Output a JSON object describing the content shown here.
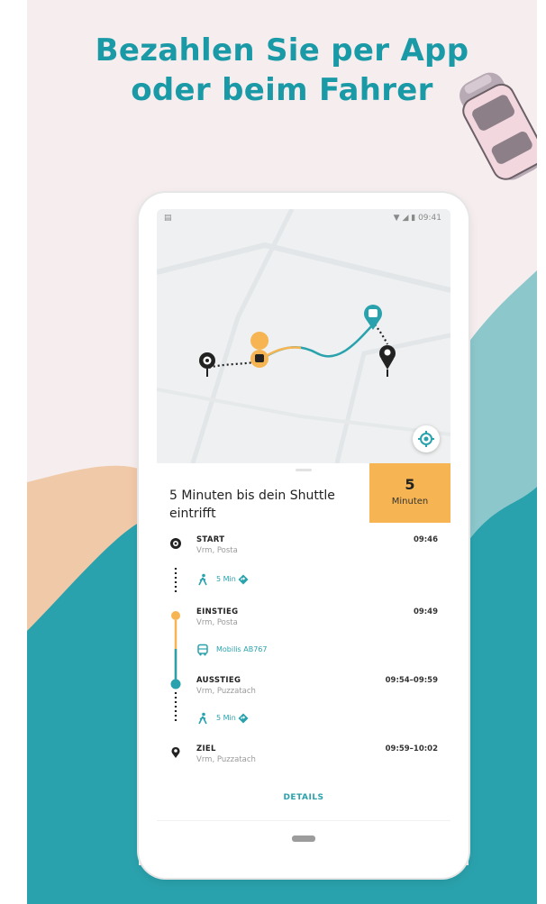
{
  "headline": {
    "line1": "Bezahlen Sie per App",
    "line2": "oder beim Fahrer",
    "color": "#1a9aa6"
  },
  "colors": {
    "teal": "#1a9aa6",
    "accent_orange": "#f6b552",
    "background_pink": "#f6eeee",
    "background_teal": "#2aa2ad"
  },
  "statusbar": {
    "left_icon": "notification-icon",
    "right_icons": [
      "wifi-icon",
      "signal-icon",
      "battery-icon"
    ],
    "time": "09:41"
  },
  "eta": {
    "message": "5 Minuten bis dein Shuttle eintrifft",
    "value": "5",
    "unit": "Minuten"
  },
  "stops": [
    {
      "title": "START",
      "subtitle": "Vrm, Posta",
      "time": "09:46",
      "icon": "origin-icon"
    },
    {
      "title": "EINSTIEG",
      "subtitle": "Vrm, Posta",
      "time": "09:49",
      "icon": "pickup-dot-icon"
    },
    {
      "title": "AUSSTIEG",
      "subtitle": "Vrm, Puzzatach",
      "time": "09:54–09:59",
      "icon": "dropoff-dot-icon"
    },
    {
      "title": "ZIEL",
      "subtitle": "Vrm, Puzzatach",
      "time": "09:59–10:02",
      "icon": "destination-pin-icon"
    }
  ],
  "segments": [
    {
      "label": "5 Min",
      "icon": "walk-icon",
      "extra_icon": "directions-icon"
    },
    {
      "label": "Mobilis AB767",
      "icon": "bus-icon"
    },
    {
      "label": "5 Min",
      "icon": "walk-icon",
      "extra_icon": "directions-icon"
    }
  ],
  "details_label": "DETAILS",
  "map": {
    "markers": [
      "origin-marker-icon",
      "shuttle-marker-icon",
      "bus-stop-marker-icon",
      "destination-marker-icon"
    ],
    "locate_icon": "locate-icon"
  }
}
